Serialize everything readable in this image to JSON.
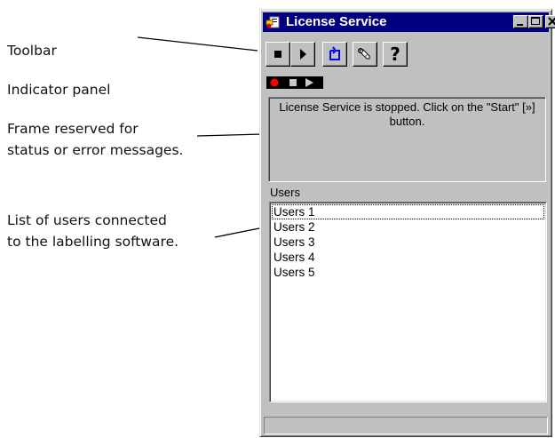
{
  "annotations": {
    "toolbar": "Toolbar",
    "indicator_panel": "Indicator panel",
    "frame": "Frame reserved for status or error messages.",
    "users": "List of users connected to the labelling software."
  },
  "window": {
    "title": "License Service",
    "title_icon": "license-app-icon",
    "controls": [
      "minimize-icon",
      "maximize-icon",
      "close-icon"
    ]
  },
  "toolbar": {
    "buttons": [
      {
        "icon": "stop-icon"
      },
      {
        "icon": "start-icon"
      },
      {
        "icon": "refresh-icon"
      },
      {
        "icon": "settings-wrench-icon"
      },
      {
        "icon": "help-icon",
        "label": "?"
      }
    ]
  },
  "indicator": {
    "lights": [
      "record-dot-icon",
      "stop-square-icon",
      "play-triangle-icon"
    ],
    "active_color": "#ff0000"
  },
  "status": {
    "message": "License Service is stopped. Click on the \"Start\" [»] button."
  },
  "users": {
    "label": "Users",
    "items": [
      "Users 1",
      "Users 2",
      "Users 3",
      "Users 4",
      "Users 5"
    ],
    "focused_index": 0
  },
  "colors": {
    "titlebar": "#000080",
    "face": "#c0c0c0",
    "refresh_icon": "#0000ff"
  }
}
